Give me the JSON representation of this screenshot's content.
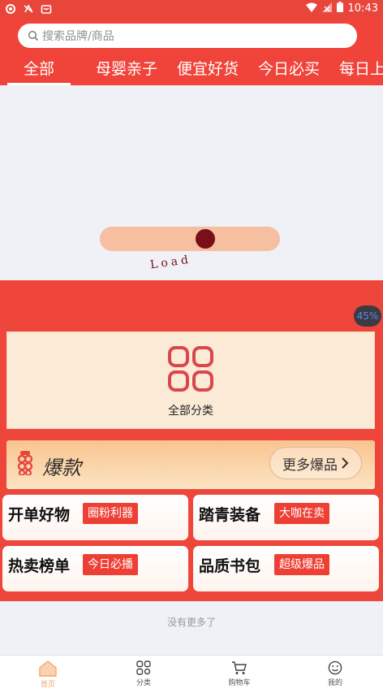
{
  "status_bar": {
    "time": "10:43"
  },
  "search": {
    "placeholder": "搜索品牌/商品"
  },
  "tabs": [
    {
      "label": "全部"
    },
    {
      "label": "母婴亲子"
    },
    {
      "label": "便宜好货"
    },
    {
      "label": "今日必买"
    },
    {
      "label": "每日上新"
    }
  ],
  "loader": {
    "text": "Load",
    "percent": "45%"
  },
  "category": {
    "label": "全部分类"
  },
  "hot": {
    "title": "爆款",
    "more_label": "更多爆品"
  },
  "tiles": [
    {
      "name": "开单好物",
      "tag": "圈粉利器"
    },
    {
      "name": "踏青装备",
      "tag": "大咖在卖"
    },
    {
      "name": "热卖榜单",
      "tag": "今日必播"
    },
    {
      "name": "品质书包",
      "tag": "超级爆品"
    }
  ],
  "footer_note": "没有更多了",
  "nav": [
    {
      "label": "首页"
    },
    {
      "label": "分类"
    },
    {
      "label": "购物车"
    },
    {
      "label": "我的"
    }
  ],
  "colors": {
    "brand_red": "#f0443a",
    "loader_dot": "#7a0e19",
    "nav_active": "#f6a46c"
  }
}
